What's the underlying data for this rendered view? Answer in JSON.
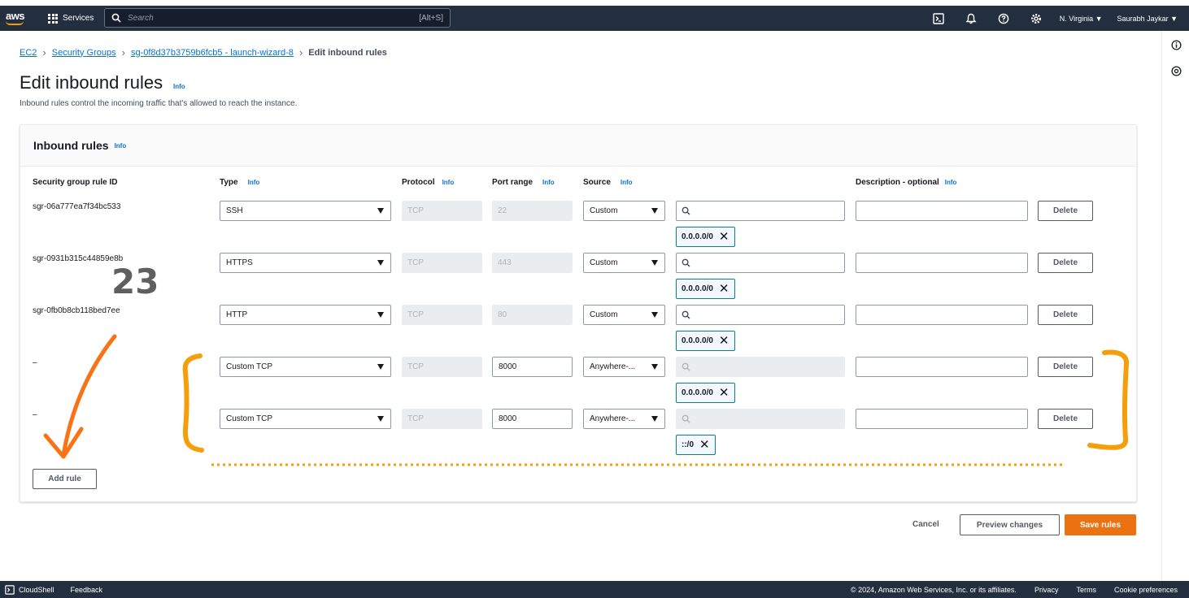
{
  "nav": {
    "logo": "aws",
    "services": "Services",
    "search_placeholder": "Search",
    "search_shortcut": "[Alt+S]",
    "region": "N. Virginia ▼",
    "user": "Saurabh Jaykar ▼"
  },
  "breadcrumb": {
    "items": [
      "EC2",
      "Security Groups",
      "sg-0f8d37b3759b6fcb5 - launch-wizard-8"
    ],
    "current": "Edit inbound rules"
  },
  "page": {
    "title": "Edit inbound rules",
    "info": "Info",
    "subtitle": "Inbound rules control the incoming traffic that's allowed to reach the instance."
  },
  "panel": {
    "title": "Inbound rules",
    "info": "Info",
    "columns": {
      "rule_id": "Security group rule ID",
      "type": "Type",
      "protocol": "Protocol",
      "port_range": "Port range",
      "source": "Source",
      "description": "Description - optional"
    },
    "rows": [
      {
        "id": "sgr-06a777ea7f34bc533",
        "type": "SSH",
        "protocol": "TCP",
        "port": "22",
        "source": "Custom",
        "token": "0.0.0.0/0",
        "delete": "Delete"
      },
      {
        "id": "sgr-0931b315c44859e8b",
        "type": "HTTPS",
        "protocol": "TCP",
        "port": "443",
        "source": "Custom",
        "token": "0.0.0.0/0",
        "delete": "Delete"
      },
      {
        "id": "sgr-0fb0b8cb118bed7ee",
        "type": "HTTP",
        "protocol": "TCP",
        "port": "80",
        "source": "Custom",
        "token": "0.0.0.0/0",
        "delete": "Delete"
      },
      {
        "id": "–",
        "type": "Custom TCP",
        "protocol": "TCP",
        "port": "8000",
        "source": "Anywhere-...",
        "token": "0.0.0.0/0",
        "delete": "Delete"
      },
      {
        "id": "–",
        "type": "Custom TCP",
        "protocol": "TCP",
        "port": "8000",
        "source": "Anywhere-...",
        "token": "::/0",
        "delete": "Delete"
      }
    ],
    "add_rule": "Add rule"
  },
  "actions": {
    "cancel": "Cancel",
    "preview": "Preview changes",
    "save": "Save rules"
  },
  "annotation": {
    "number": "23",
    "color": "#f59e0b",
    "arrow_color": "#f97316"
  },
  "footer": {
    "cloudshell": "CloudShell",
    "feedback": "Feedback",
    "copyright": "© 2024, Amazon Web Services, Inc. or its affiliates.",
    "privacy": "Privacy",
    "terms": "Terms",
    "cookies": "Cookie preferences"
  }
}
